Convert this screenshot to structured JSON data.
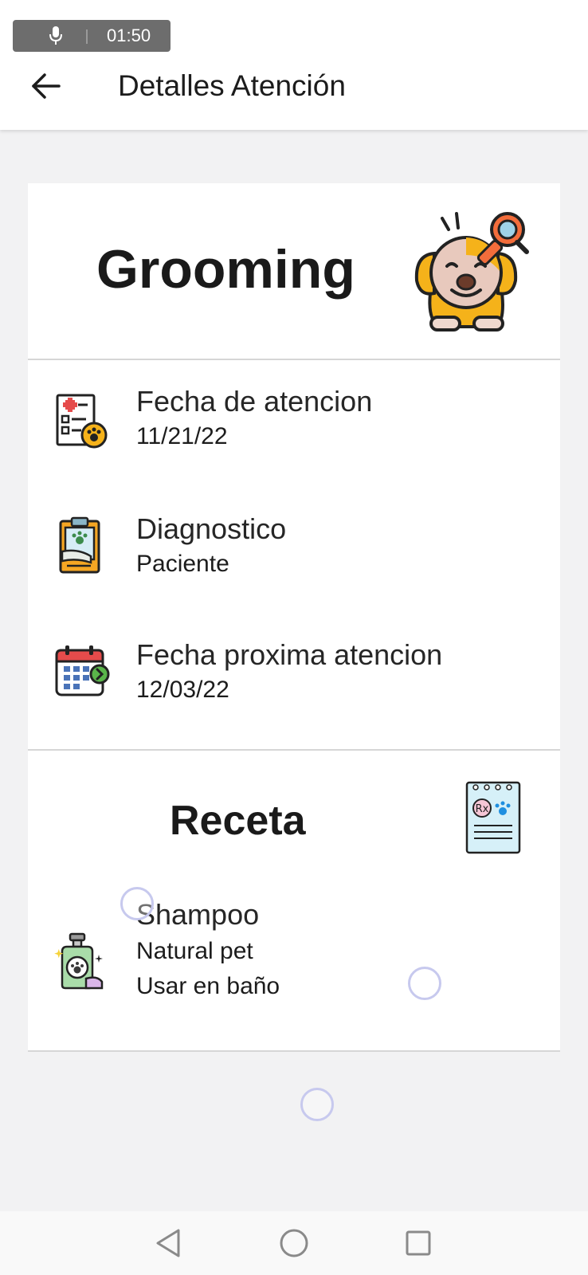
{
  "status_bar": {
    "time": "01:50",
    "mic_icon": "microphone-icon"
  },
  "app_bar": {
    "title": "Detalles Atención",
    "back_icon": "arrow-left-icon"
  },
  "service": {
    "name": "Grooming",
    "illustration": "dog-grooming-dryer-icon"
  },
  "details": [
    {
      "label": "Fecha de atencion",
      "value": "11/21/22",
      "icon": "medical-record-paw-icon"
    },
    {
      "label": "Diagnostico",
      "value": "Paciente",
      "icon": "clipboard-paw-icon"
    },
    {
      "label": "Fecha proxima atencion",
      "value": "12/03/22",
      "icon": "calendar-next-icon"
    }
  ],
  "receta": {
    "title": "Receta",
    "illustration": "prescription-pad-icon",
    "items": [
      {
        "name": "Shampoo",
        "type": "Natural pet",
        "usage": "Usar en baño",
        "icon": "pet-shampoo-bottle-icon"
      }
    ]
  },
  "nav_bar": {
    "back_icon": "triangle-back-icon",
    "home_icon": "circle-home-icon",
    "recents_icon": "square-recents-icon"
  }
}
